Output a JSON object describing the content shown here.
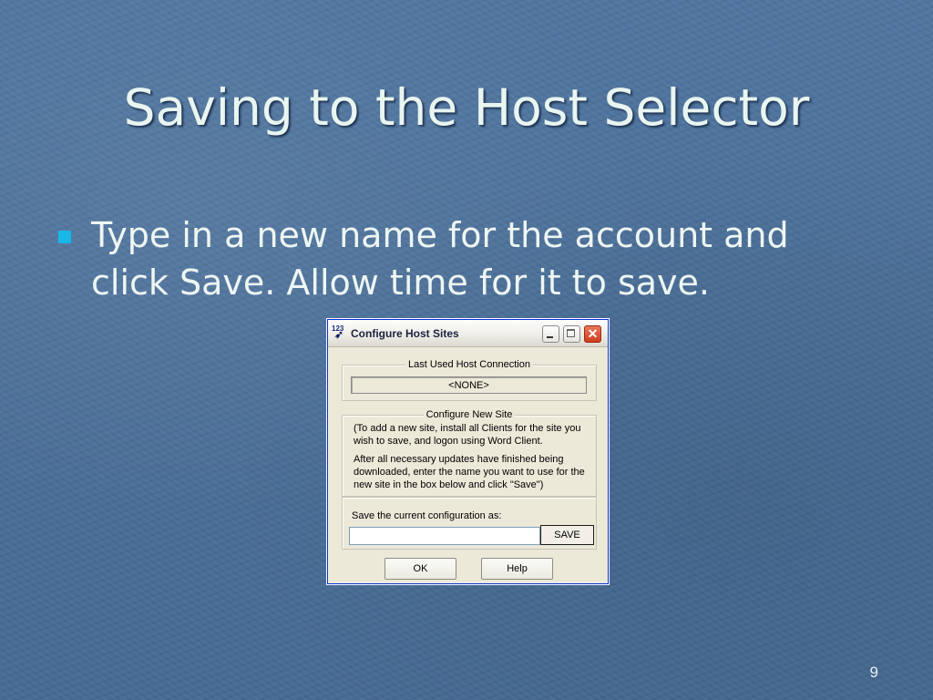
{
  "slide": {
    "title": "Saving to the Host Selector",
    "bullet": "Type in a new name for the account and click Save. Allow time for it to save.",
    "page_number": "9"
  },
  "dialog": {
    "title": "Configure Host Sites",
    "app_icon_digits": "123",
    "close_glyph": "✕",
    "last_used": {
      "label": "Last Used Host Connection",
      "value": "<NONE>"
    },
    "configure_new": {
      "label": "Configure New Site",
      "paragraph1": "(To add a new site, install all Clients for the site you wish to save, and logon using Word Client.",
      "paragraph2": "After all necessary updates have finished being downloaded, enter the name you want to use for the new site in the box below and click \"Save\")"
    },
    "save_config": {
      "label": "Save the current configuration as:",
      "input_value": "",
      "save_button": "SAVE"
    },
    "ok_button": "OK",
    "help_button": "Help"
  }
}
